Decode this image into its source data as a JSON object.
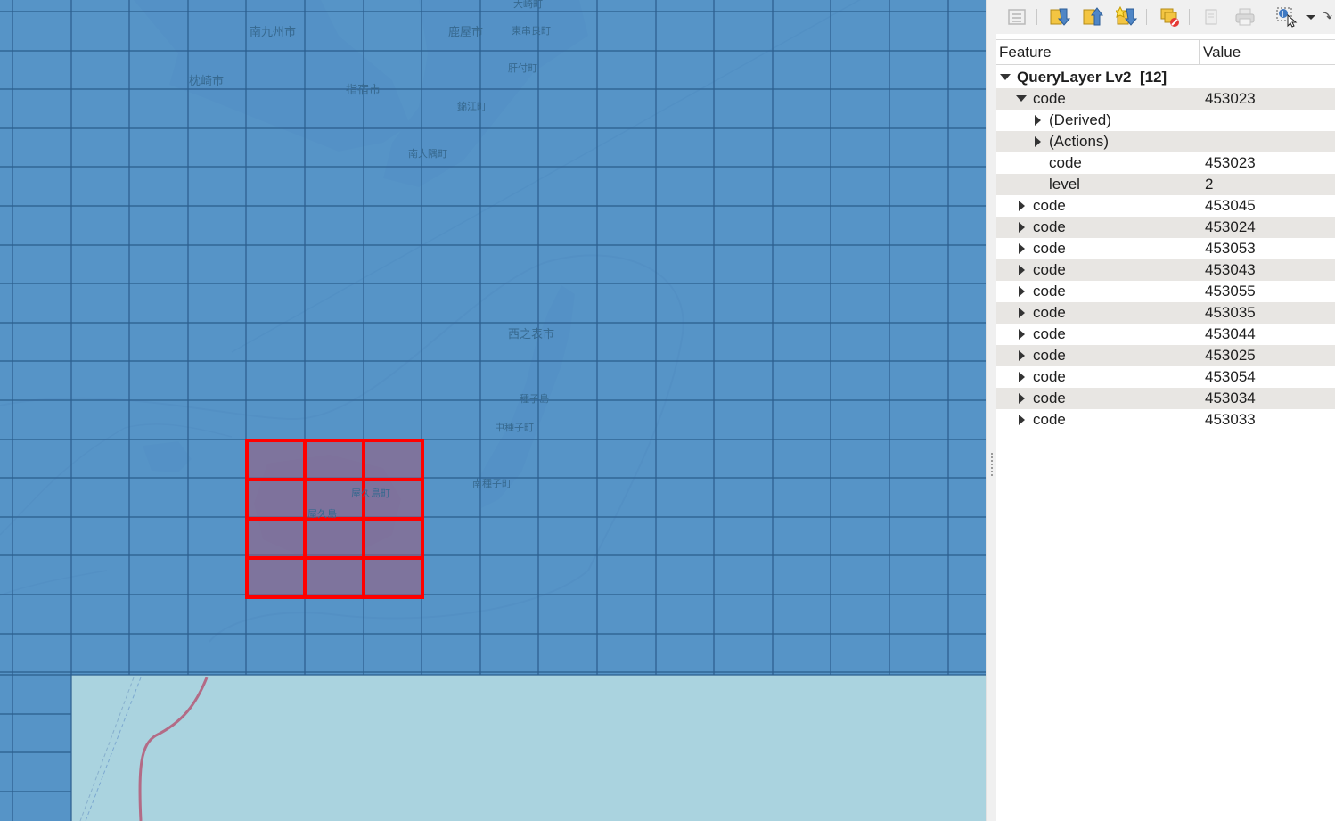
{
  "map": {
    "sea_color": "#aad3df",
    "grid_fill_color": "#4f8ec4",
    "grid_line_color": "#2b5d8d",
    "selection_color": "#ff0000",
    "place_labels": [
      "大崎町",
      "南九州市",
      "鹿屋市",
      "東串良町",
      "肝付町",
      "枕崎市",
      "指宿市",
      "錦江町",
      "南大隅町",
      "西之表市",
      "種子島",
      "中種子町",
      "南種子町",
      "屋久島町",
      "屋久島"
    ]
  },
  "panel": {
    "toolbar": {
      "buttons": [
        {
          "name": "expand-all-icon"
        },
        {
          "name": "expand-tree-icon"
        },
        {
          "name": "collapse-tree-icon"
        },
        {
          "name": "expand-new-results-icon"
        },
        {
          "name": "clear-results-icon"
        },
        {
          "name": "copy-feature-icon"
        },
        {
          "name": "print-icon"
        },
        {
          "name": "identify-select-icon"
        },
        {
          "name": "dropdown-arrow-icon"
        },
        {
          "name": "close-icon"
        }
      ]
    },
    "header": {
      "feature": "Feature",
      "value": "Value"
    },
    "layer": {
      "name": "QueryLayer Lv2",
      "count": "[12]"
    },
    "expanded_feature": {
      "label": "code",
      "value": "453023",
      "children": [
        {
          "label": "(Derived)",
          "value": ""
        },
        {
          "label": "(Actions)",
          "value": ""
        },
        {
          "label": "code",
          "value": "453023"
        },
        {
          "label": "level",
          "value": "2"
        }
      ]
    },
    "features": [
      {
        "label": "code",
        "value": "453045"
      },
      {
        "label": "code",
        "value": "453024"
      },
      {
        "label": "code",
        "value": "453053"
      },
      {
        "label": "code",
        "value": "453043"
      },
      {
        "label": "code",
        "value": "453055"
      },
      {
        "label": "code",
        "value": "453035"
      },
      {
        "label": "code",
        "value": "453044"
      },
      {
        "label": "code",
        "value": "453025"
      },
      {
        "label": "code",
        "value": "453054"
      },
      {
        "label": "code",
        "value": "453034"
      },
      {
        "label": "code",
        "value": "453033"
      }
    ]
  }
}
